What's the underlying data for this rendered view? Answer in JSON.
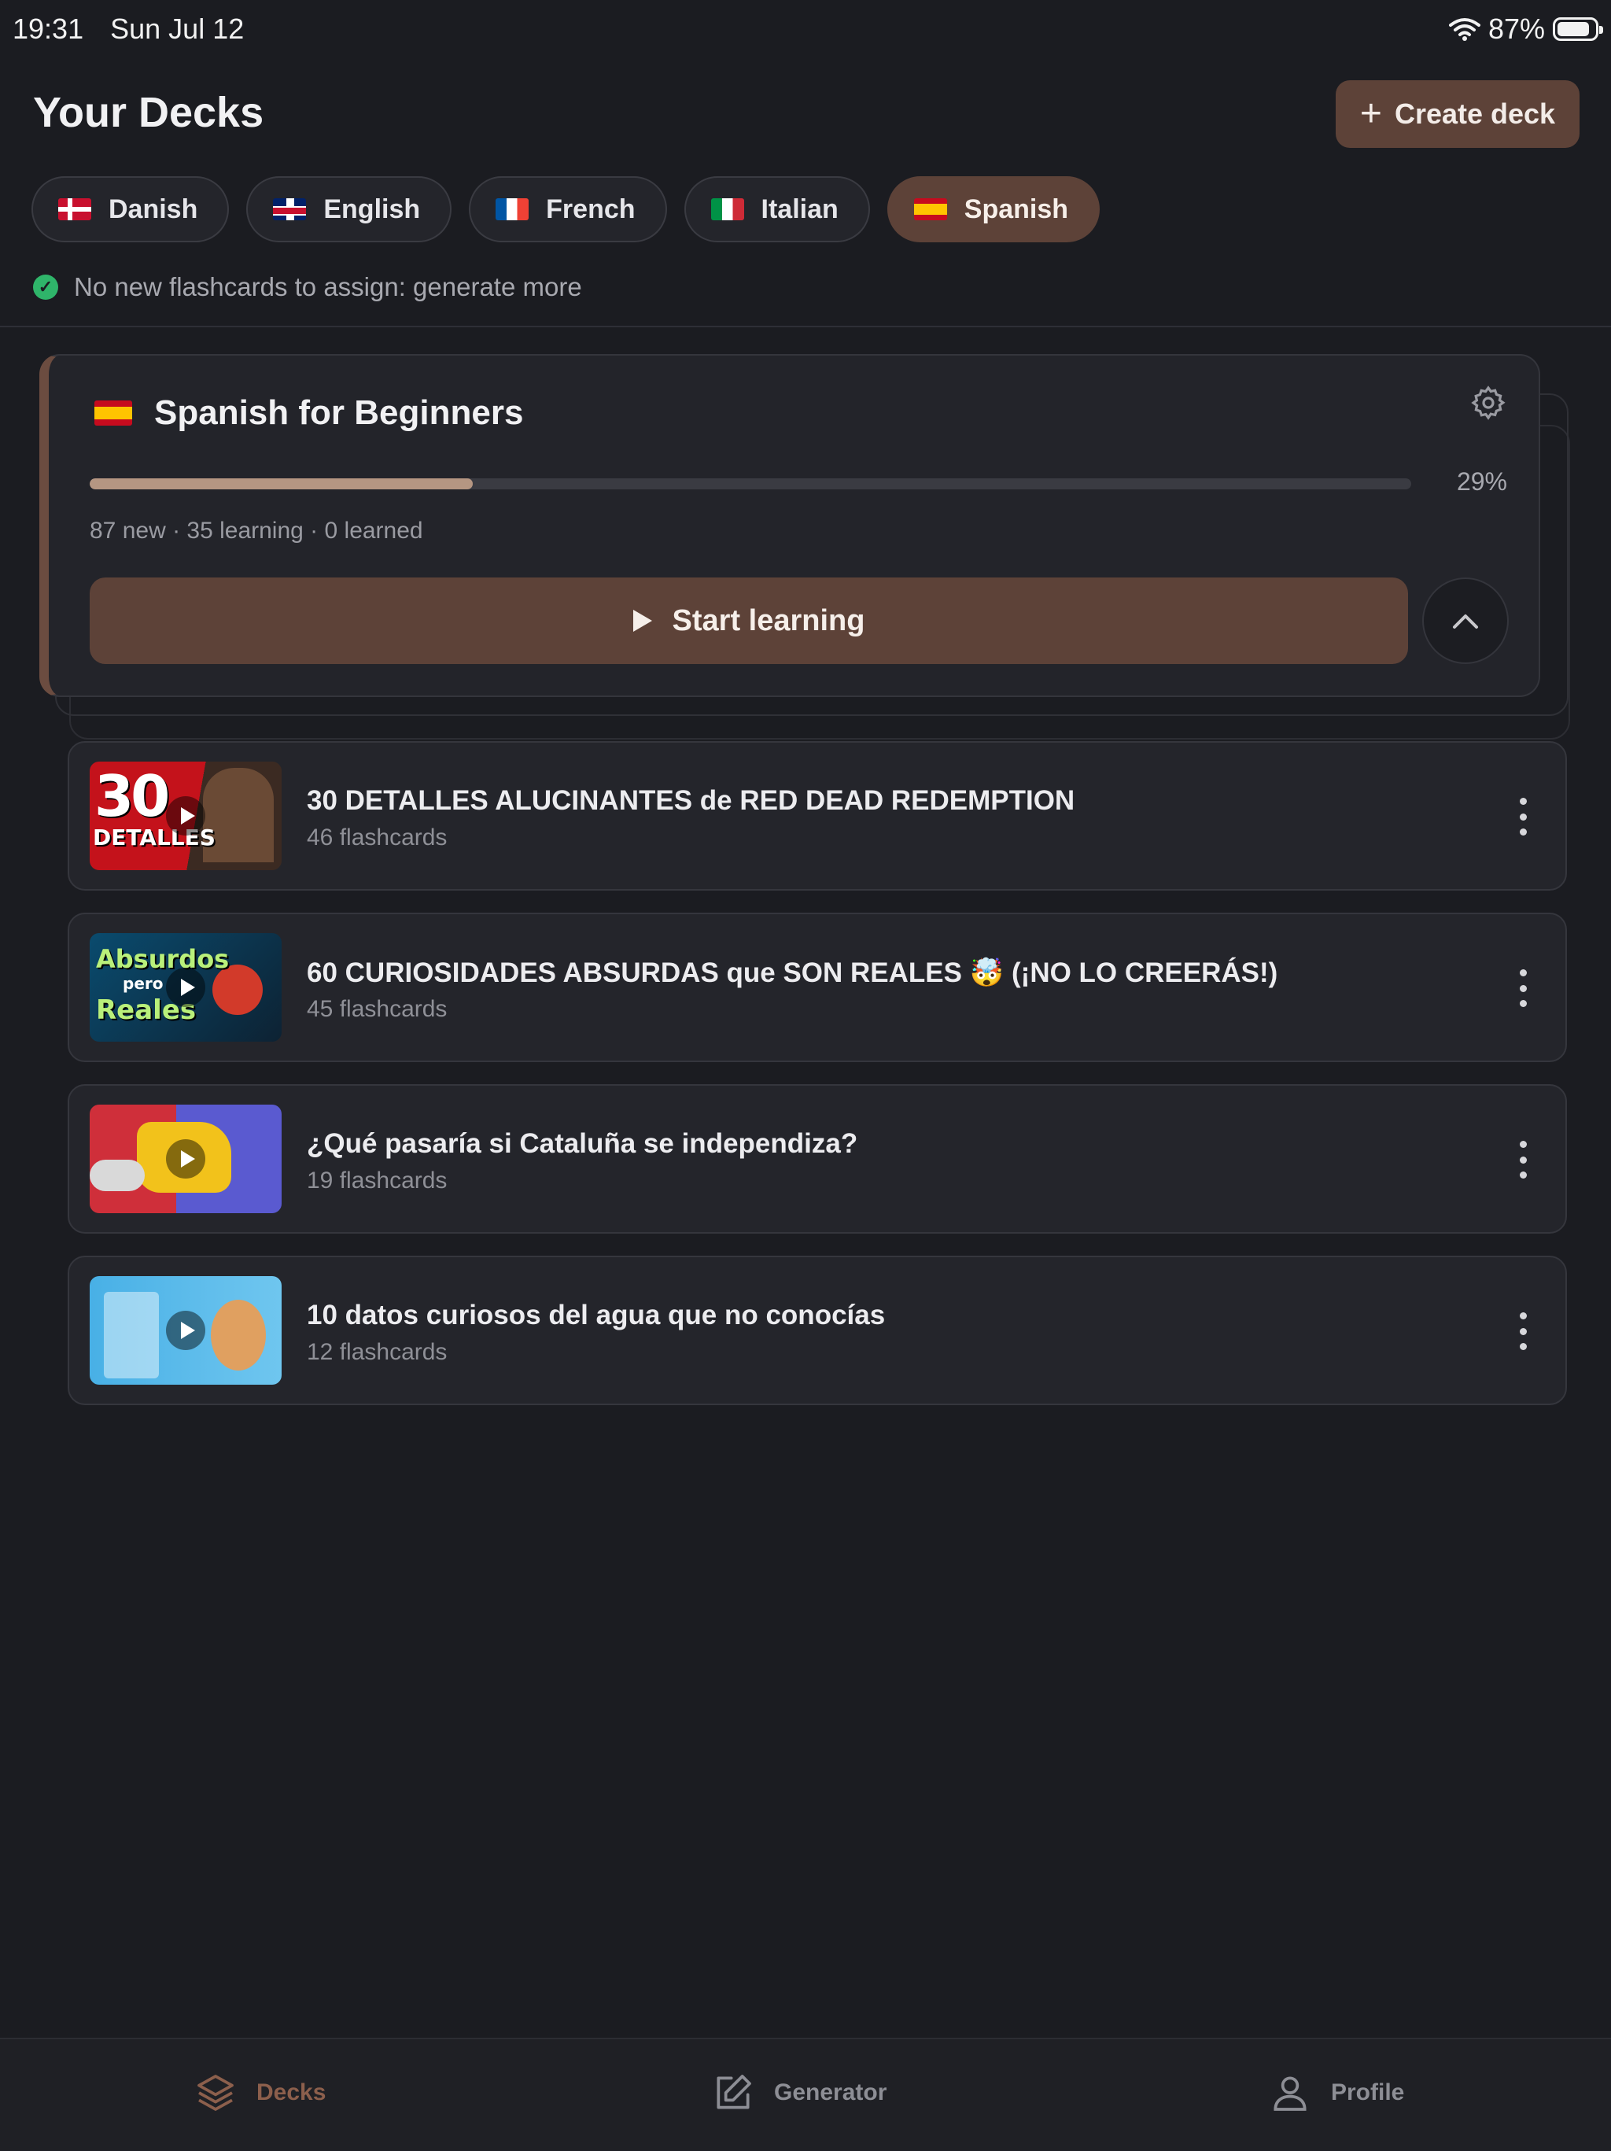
{
  "status_bar": {
    "time": "19:31",
    "date": "Sun Jul 12",
    "battery": "87%"
  },
  "header": {
    "title": "Your Decks",
    "create_label": "Create deck"
  },
  "languages": [
    {
      "label": "Danish",
      "flag": "danish-flag"
    },
    {
      "label": "English",
      "flag": "uk-flag"
    },
    {
      "label": "French",
      "flag": "french-flag"
    },
    {
      "label": "Italian",
      "flag": "italian-flag"
    },
    {
      "label": "Spanish",
      "flag": "spanish-flag",
      "selected": true
    }
  ],
  "notice": "No new flashcards to assign: generate more",
  "deck": {
    "title": "Spanish for Beginners",
    "progress_value": 29,
    "progress_label": "29%",
    "stats": "87 new · 35 learning · 0 learned",
    "start_label": "Start learning"
  },
  "videos": [
    {
      "title": "30 DETALLES ALUCINANTES de RED DEAD REDEMPTION",
      "count": "46 flashcards",
      "thumb_text": [
        "30",
        "DETALLES"
      ]
    },
    {
      "title": "60 CURIOSIDADES ABSURDAS que SON REALES 🤯 (¡NO LO CREERÁS!)",
      "count": "45 flashcards",
      "thumb_text": [
        "Absurdos",
        "pero",
        "Reales"
      ]
    },
    {
      "title": "¿Qué pasaría si Cataluña se independiza?",
      "count": "19 flashcards"
    },
    {
      "title": "10 datos curiosos del agua que no conocías",
      "count": "12 flashcards"
    }
  ],
  "tabs": [
    {
      "label": "Decks",
      "icon": "layers-icon",
      "active": true
    },
    {
      "label": "Generator",
      "icon": "edit-icon"
    },
    {
      "label": "Profile",
      "icon": "user-icon"
    }
  ],
  "colors": {
    "accent": "#5d4238",
    "background": "#1b1c21",
    "success": "#2fb56a"
  }
}
